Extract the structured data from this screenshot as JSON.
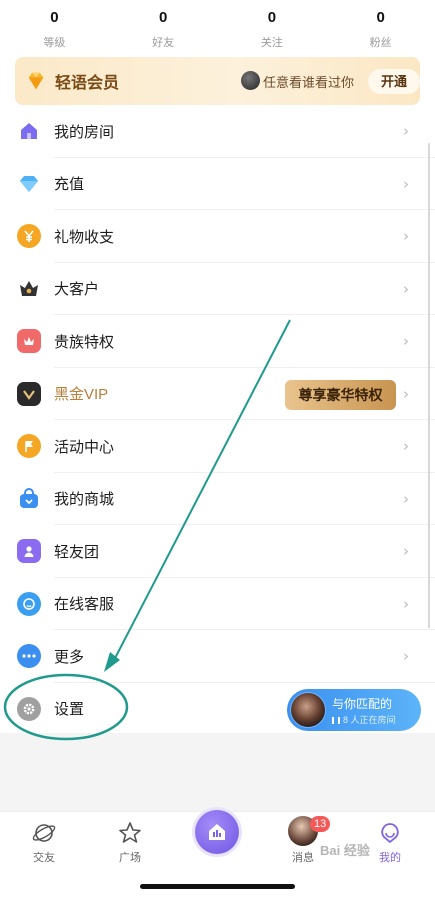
{
  "stats": [
    {
      "value": "0",
      "label": "等级"
    },
    {
      "value": "0",
      "label": "好友"
    },
    {
      "value": "0",
      "label": "关注"
    },
    {
      "value": "0",
      "label": "粉丝"
    }
  ],
  "vip_banner": {
    "title": "轻语会员",
    "hint": "任意看谁看过你",
    "button": "开通"
  },
  "menu": [
    {
      "label": "我的房间",
      "icon": "house-icon",
      "color": "#7b6cf0"
    },
    {
      "label": "充值",
      "icon": "diamond-icon",
      "color": "#4fb2f5"
    },
    {
      "label": "礼物收支",
      "icon": "yen-coin-icon",
      "color": "#f5a623"
    },
    {
      "label": "大客户",
      "icon": "crown-icon",
      "color": "#333333"
    },
    {
      "label": "贵族特权",
      "icon": "noble-crown-icon",
      "color": "#f06a6a"
    },
    {
      "label": "黑金VIP",
      "icon": "black-gold-vip-icon",
      "color": "#2a2a2a",
      "badge": "尊享豪华特权"
    },
    {
      "label": "活动中心",
      "icon": "flag-icon",
      "color": "#f5a623"
    },
    {
      "label": "我的商城",
      "icon": "shopping-bag-icon",
      "color": "#3a8ff0"
    },
    {
      "label": "轻友团",
      "icon": "user-icon",
      "color": "#8b6cf0"
    },
    {
      "label": "在线客服",
      "icon": "chat-bubble-icon",
      "color": "#3a9ff0"
    },
    {
      "label": "更多",
      "icon": "more-dots-icon",
      "color": "#3a8ff0"
    },
    {
      "label": "设置",
      "icon": "gear-icon",
      "color": "#9a9a9a"
    }
  ],
  "chevron": "›",
  "match_card": {
    "title": "与你匹配的",
    "subtitle": "8 人正在房间"
  },
  "tabbar": [
    {
      "label": "交友",
      "icon": "planet-icon"
    },
    {
      "label": "广场",
      "icon": "star-icon"
    },
    {
      "label": "",
      "icon": "home-bars-icon"
    },
    {
      "label": "消息",
      "icon": "message-avatar-icon",
      "badge": "13"
    },
    {
      "label": "我的",
      "icon": "profile-icon",
      "active": true
    }
  ],
  "watermark": "Bai 经验"
}
